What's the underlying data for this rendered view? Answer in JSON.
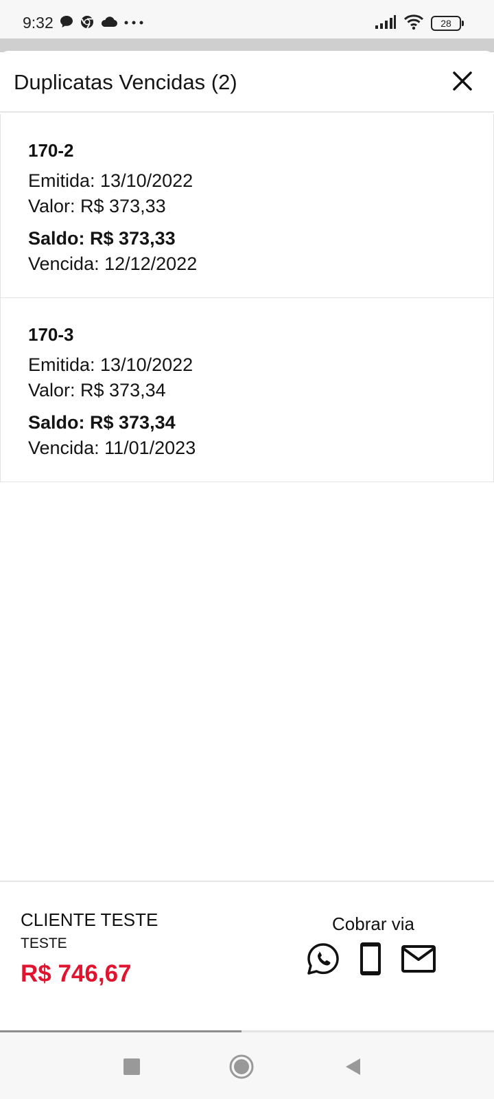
{
  "status_bar": {
    "time": "9:32",
    "battery": "28",
    "left_icons": [
      "chat-bubble-icon",
      "chrome-icon",
      "cloud-icon",
      "more-dots-icon"
    ],
    "right_icons": [
      "signal-icon",
      "wifi-icon",
      "battery-icon"
    ]
  },
  "sheet": {
    "title": "Duplicatas Vencidas (2)",
    "close_icon": "close-icon"
  },
  "duplicatas": [
    {
      "code": "170-2",
      "emitida": "Emitida: 13/10/2022",
      "valor": "Valor: R$ 373,33",
      "saldo": "Saldo: R$ 373,33",
      "vencida": "Vencida: 12/12/2022"
    },
    {
      "code": "170-3",
      "emitida": "Emitida: 13/10/2022",
      "valor": "Valor: R$ 373,34",
      "saldo": "Saldo: R$ 373,34",
      "vencida": "Vencida: 11/01/2023"
    }
  ],
  "footer": {
    "client_name": "CLIENTE TESTE",
    "client_sub": "TESTE",
    "total": "R$ 746,67",
    "cobrar_label": "Cobrar via",
    "channels": [
      "whatsapp-icon",
      "phone-icon",
      "mail-icon"
    ]
  },
  "colors": {
    "total": "#e0142f",
    "text": "#111111",
    "divider": "#e6e6e6"
  },
  "nav": [
    "recents-square-icon",
    "home-circle-icon",
    "back-triangle-icon"
  ]
}
